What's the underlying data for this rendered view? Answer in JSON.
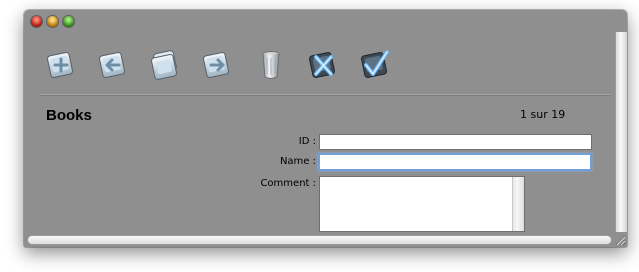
{
  "window": {
    "controls": [
      "close-icon",
      "minimize-icon",
      "zoom-icon"
    ]
  },
  "toolbar": {
    "icons": [
      "add-record-icon",
      "previous-record-icon",
      "copy-record-icon",
      "next-record-icon",
      "delete-trash-icon",
      "cancel-edit-icon",
      "validate-check-icon"
    ]
  },
  "form": {
    "title": "Books",
    "counter": "1 sur 19",
    "fields": {
      "id_label": "ID :",
      "id_value": "",
      "name_label": "Name :",
      "name_value": "",
      "comment_label": "Comment :",
      "comment_value": ""
    }
  },
  "colors": {
    "window_bg": "#8f8f8f",
    "focus_ring": "#6f9fd6"
  }
}
